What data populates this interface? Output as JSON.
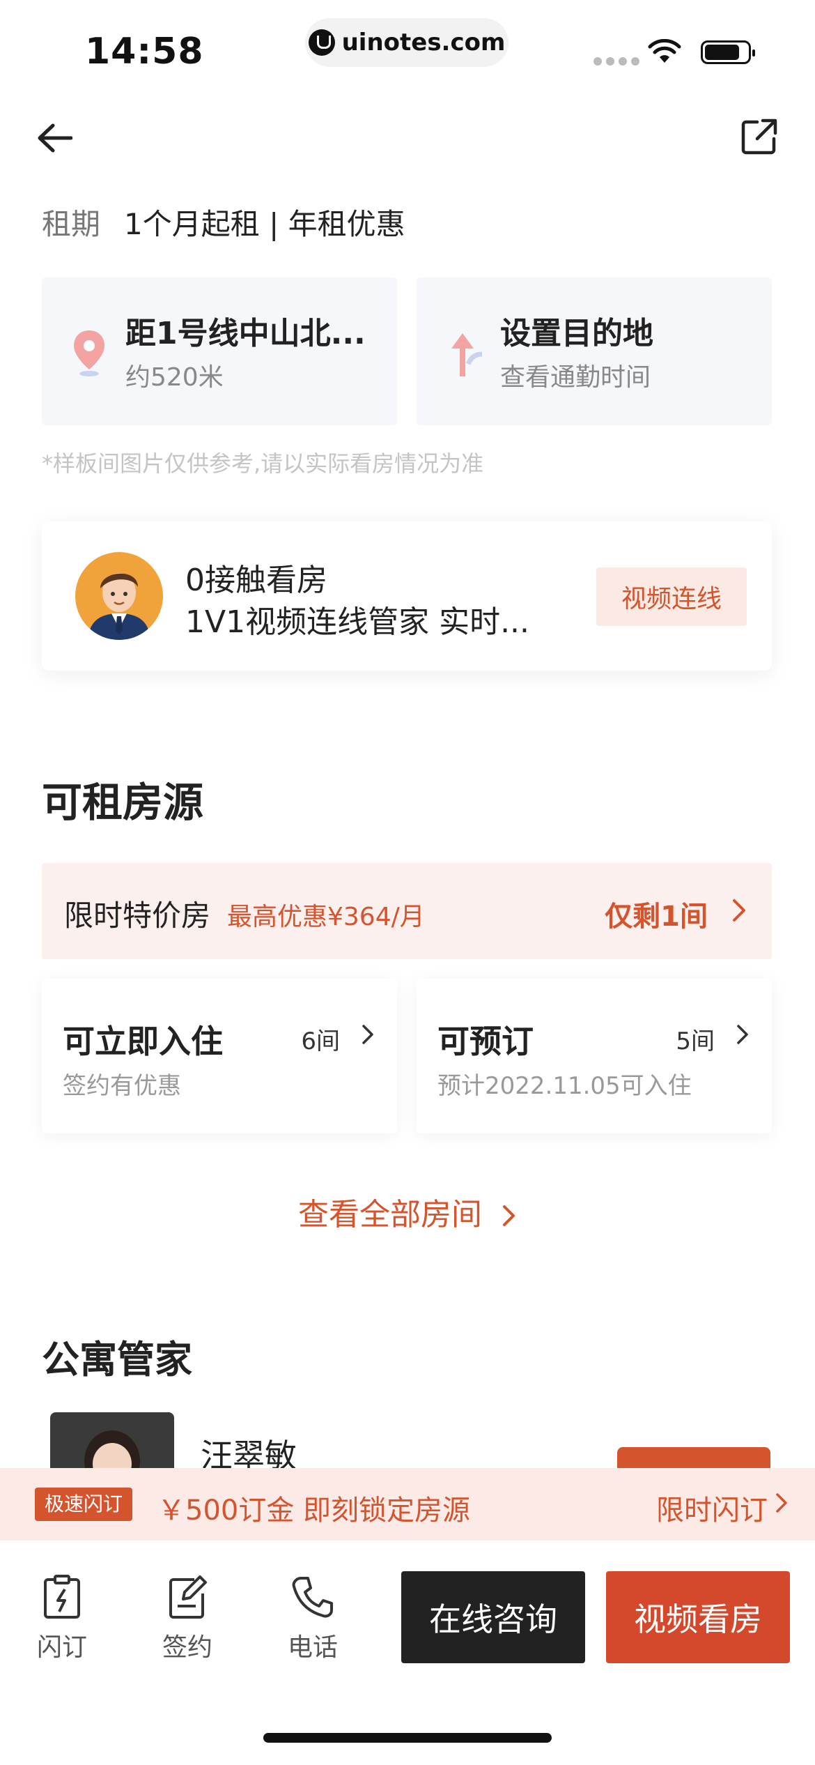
{
  "status_bar": {
    "time": "14:58",
    "url": "uinotes.com"
  },
  "lease": {
    "label": "租期",
    "value": "1个月起租 | 年租优惠"
  },
  "location_cards": [
    {
      "title": "距1号线中山北...",
      "subtitle": "约520米",
      "icon": "map-pin-icon"
    },
    {
      "title": "设置目的地",
      "subtitle": "查看通勤时间",
      "icon": "route-arrow-icon"
    }
  ],
  "disclaimer": "*样板间图片仅供参考,请以实际看房情况为准",
  "agent_card": {
    "line1": "0接触看房",
    "line2": "1V1视频连线管家  实时...",
    "button": "视频连线"
  },
  "available_section": {
    "title": "可租房源",
    "promo": {
      "label": "限时特价房",
      "discount": "最高优惠¥364/月",
      "remaining": "仅剩1间"
    },
    "cards": [
      {
        "title": "可立即入住",
        "count": "6间",
        "subtitle": "签约有优惠"
      },
      {
        "title": "可预订",
        "count": "5间",
        "subtitle": "预计2022.11.05可入住"
      }
    ],
    "view_all": "查看全部房间"
  },
  "manager_section": {
    "title": "公寓管家",
    "name": "汪翠敏"
  },
  "flash_bar": {
    "tag": "极速闪订",
    "text": "￥500订金 即刻锁定房源",
    "right": "限时闪订"
  },
  "bottom_bar": {
    "tabs": [
      {
        "label": "闪订",
        "icon": "flash-clipboard-icon"
      },
      {
        "label": "签约",
        "icon": "sign-edit-icon"
      },
      {
        "label": "电话",
        "icon": "phone-icon"
      }
    ],
    "consult_button": "在线咨询",
    "video_button": "视频看房"
  },
  "colors": {
    "accent": "#d4542e",
    "dark_button": "#222222",
    "card_bg": "#f5f7fb"
  }
}
